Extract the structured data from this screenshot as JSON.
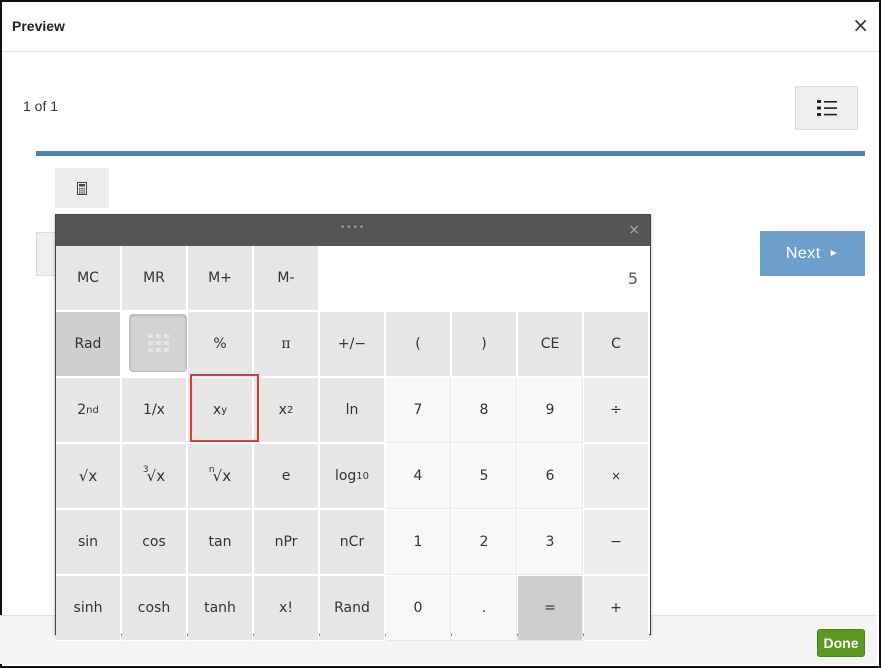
{
  "window": {
    "title": "Preview",
    "close_glyph": "×"
  },
  "nav": {
    "counter": "1 of 1",
    "next_label": "Next",
    "next_arrow": "►",
    "list_icon": "list-icon"
  },
  "toolbar": {
    "calculator_icon": "calculator-icon"
  },
  "footer": {
    "done_label": "Done"
  },
  "calculator": {
    "close_glyph": "×",
    "grip": "••••",
    "display_value": "5",
    "memory": [
      "MC",
      "MR",
      "M+",
      "M-"
    ],
    "row1": [
      "Rad",
      "",
      "%",
      "π",
      "+/−",
      "(",
      ")",
      "CE",
      "C"
    ],
    "row2": [
      "2nd",
      "1/x",
      "xy",
      "x2",
      "ln",
      "7",
      "8",
      "9",
      "÷"
    ],
    "row3": [
      "√x",
      "3√x",
      "n√x",
      "e",
      "log10",
      "4",
      "5",
      "6",
      "×"
    ],
    "row4": [
      "sin",
      "cos",
      "tan",
      "nPr",
      "nCr",
      "1",
      "2",
      "3",
      "−"
    ],
    "row5": [
      "sinh",
      "cosh",
      "tanh",
      "x!",
      "Rand",
      "0",
      ".",
      "=",
      "+"
    ],
    "labels": {
      "second_base": "2",
      "second_sup": "nd",
      "xy_base": "x",
      "xy_sup": "y",
      "x2_base": "x",
      "x2_sup": "2",
      "log_base": "log",
      "log_sub": "10",
      "root_pre3": "3",
      "root_pren": "n",
      "root_sym": "√x"
    },
    "highlight_color": "#e03a30"
  },
  "colors": {
    "progress": "#4e84b5",
    "next": "#6f9fcd",
    "done": "#5a9a1f"
  }
}
